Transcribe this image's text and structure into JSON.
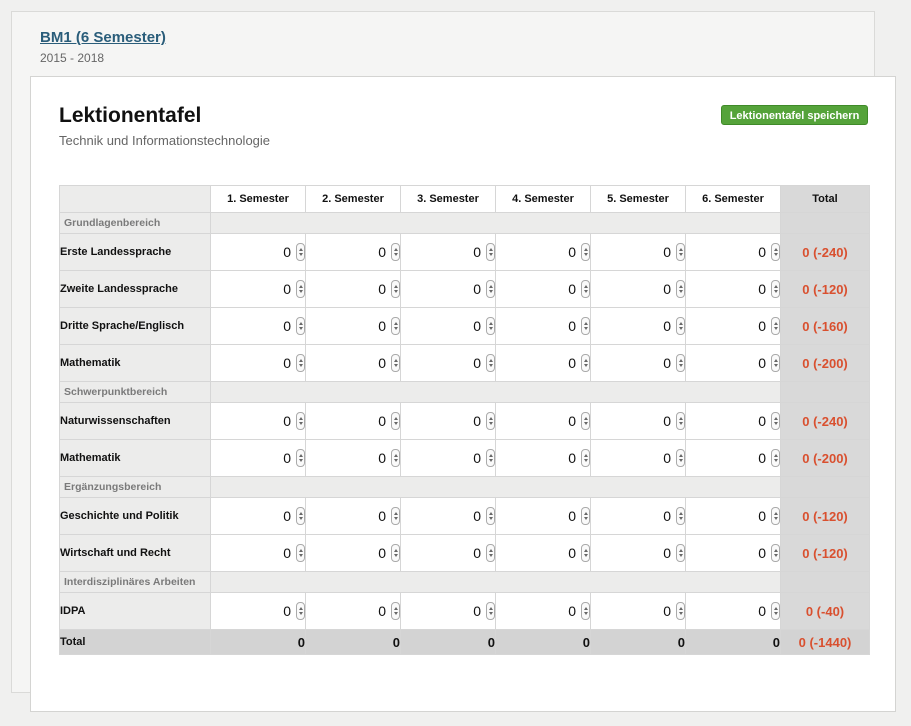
{
  "program": {
    "title": "BM1 (6 Semester)",
    "years": "2015 - 2018"
  },
  "header": {
    "title": "Lektionentafel",
    "subtitle": "Technik und Informationstechnologie",
    "save_label": "Lektionentafel speichern"
  },
  "colors": {
    "accent_green": "#55a33a",
    "negative_red": "#d9502f",
    "link_blue": "#2a5d7a"
  },
  "table": {
    "columns": [
      "1. Semester",
      "2. Semester",
      "3. Semester",
      "4. Semester",
      "5. Semester",
      "6. Semester",
      "Total"
    ],
    "sections": [
      {
        "label": "Grundlagenbereich",
        "rows": [
          {
            "name": "Erste Landessprache",
            "values": [
              "0",
              "0",
              "0",
              "0",
              "0",
              "0"
            ],
            "total": "0 (-240)"
          },
          {
            "name": "Zweite Landessprache",
            "values": [
              "0",
              "0",
              "0",
              "0",
              "0",
              "0"
            ],
            "total": "0 (-120)"
          },
          {
            "name": "Dritte Sprache/Englisch",
            "values": [
              "0",
              "0",
              "0",
              "0",
              "0",
              "0"
            ],
            "total": "0 (-160)"
          },
          {
            "name": "Mathematik",
            "values": [
              "0",
              "0",
              "0",
              "0",
              "0",
              "0"
            ],
            "total": "0 (-200)"
          }
        ]
      },
      {
        "label": "Schwerpunktbereich",
        "rows": [
          {
            "name": "Naturwissenschaften",
            "values": [
              "0",
              "0",
              "0",
              "0",
              "0",
              "0"
            ],
            "total": "0 (-240)"
          },
          {
            "name": "Mathematik",
            "values": [
              "0",
              "0",
              "0",
              "0",
              "0",
              "0"
            ],
            "total": "0 (-200)"
          }
        ]
      },
      {
        "label": "Ergänzungsbereich",
        "rows": [
          {
            "name": "Geschichte und Politik",
            "values": [
              "0",
              "0",
              "0",
              "0",
              "0",
              "0"
            ],
            "total": "0 (-120)"
          },
          {
            "name": "Wirtschaft und Recht",
            "values": [
              "0",
              "0",
              "0",
              "0",
              "0",
              "0"
            ],
            "total": "0 (-120)"
          }
        ]
      },
      {
        "label": "Interdisziplinäres Arbeiten",
        "rows": [
          {
            "name": "IDPA",
            "values": [
              "0",
              "0",
              "0",
              "0",
              "0",
              "0"
            ],
            "total": "0 (-40)"
          }
        ]
      }
    ],
    "totals": {
      "label": "Total",
      "values": [
        "0",
        "0",
        "0",
        "0",
        "0",
        "0"
      ],
      "grand": "0 (-1440)"
    }
  }
}
